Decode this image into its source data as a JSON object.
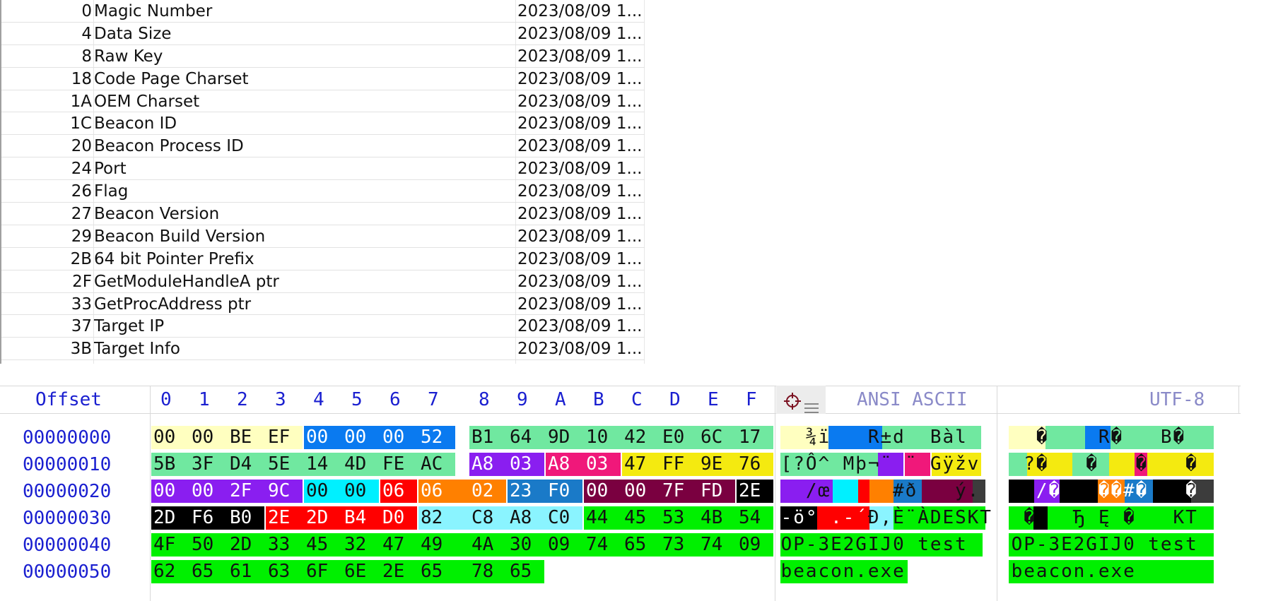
{
  "template_table": {
    "rows": [
      {
        "offset": "0",
        "name": "Magic Number",
        "date": "2023/08/09  1..."
      },
      {
        "offset": "4",
        "name": "Data Size",
        "date": "2023/08/09  1..."
      },
      {
        "offset": "8",
        "name": "Raw Key",
        "date": "2023/08/09  1..."
      },
      {
        "offset": "18",
        "name": "Code Page Charset",
        "date": "2023/08/09  1..."
      },
      {
        "offset": "1A",
        "name": "OEM Charset",
        "date": "2023/08/09  1..."
      },
      {
        "offset": "1C",
        "name": "Beacon ID",
        "date": "2023/08/09  1..."
      },
      {
        "offset": "20",
        "name": "Beacon Process ID",
        "date": "2023/08/09  1..."
      },
      {
        "offset": "24",
        "name": "Port",
        "date": "2023/08/09  1..."
      },
      {
        "offset": "26",
        "name": "Flag",
        "date": "2023/08/09  1..."
      },
      {
        "offset": "27",
        "name": "Beacon Version",
        "date": "2023/08/09  1..."
      },
      {
        "offset": "29",
        "name": "Beacon Build Version",
        "date": "2023/08/09  1..."
      },
      {
        "offset": "2B",
        "name": "64 bit Pointer Prefix",
        "date": "2023/08/09  1..."
      },
      {
        "offset": "2F",
        "name": "GetModuleHandleA ptr",
        "date": "2023/08/09  1..."
      },
      {
        "offset": "33",
        "name": "GetProcAddress ptr",
        "date": "2023/08/09  1..."
      },
      {
        "offset": "37",
        "name": "Target IP",
        "date": "2023/08/09  1..."
      },
      {
        "offset": "3B",
        "name": "Target Info",
        "date": "2023/08/09  1..."
      }
    ]
  },
  "hex_view": {
    "offset_header": "Offset",
    "col_headers": [
      "0",
      "1",
      "2",
      "3",
      "4",
      "5",
      "6",
      "7",
      "8",
      "9",
      "A",
      "B",
      "C",
      "D",
      "E",
      "F"
    ],
    "ansi_header": "ANSI ASCII",
    "utf8_header": "UTF-8",
    "header_icons": [
      "crosshair-icon",
      "lines-icon"
    ],
    "colors": {
      "header_text": "#1a1fd0",
      "ansi_header_text": "#8a8ac8",
      "magic": "#ffffc0",
      "data_size": "#0a7af0",
      "raw_key": "#70e8a0",
      "charset": "#8a1ef0",
      "oem_charset": "#f0187a",
      "beacon_id": "#f4ea10",
      "process_id": "#8a1ef0",
      "port": "#00f0ff",
      "flag": "#ff0000",
      "version": "#ff8000",
      "build": "#1a7ac8",
      "ptr_prefix": "#7a0040",
      "gmh_ptr": "#000000",
      "gpa_ptr": "#ff0000",
      "target_ip": "#8af4ff",
      "target_info": "#00f000",
      "extra": "#3c3c3c"
    },
    "rows": [
      {
        "offset": "00000000",
        "bytes": [
          "00",
          "00",
          "BE",
          "EF",
          "00",
          "00",
          "00",
          "52",
          "B1",
          "64",
          "9D",
          "10",
          "42",
          "E0",
          "6C",
          "17"
        ],
        "ansi": [
          "",
          "",
          "¾",
          "ï",
          "",
          "",
          "",
          "R",
          "±",
          "d",
          "",
          "",
          "B",
          "à",
          "l",
          ""
        ],
        "utf8": [
          "",
          "",
          "�",
          "",
          "",
          "",
          "",
          "R",
          "�",
          "",
          "",
          "",
          "B",
          "�",
          "",
          ""
        ]
      },
      {
        "offset": "00000010",
        "bytes": [
          "5B",
          "3F",
          "D4",
          "5E",
          "14",
          "4D",
          "FE",
          "AC",
          "A8",
          "03",
          "A8",
          "03",
          "47",
          "FF",
          "9E",
          "76"
        ],
        "ansi": [
          "[",
          "?",
          "Ô",
          "^",
          "",
          "M",
          "þ",
          "¬",
          "¨",
          "",
          "¨",
          "",
          "G",
          "ÿ",
          "ž",
          "v"
        ],
        "utf8": [
          "",
          "?",
          "�",
          "",
          "",
          "",
          "�",
          "",
          "",
          "",
          "�",
          "",
          "",
          "",
          "�",
          ""
        ]
      },
      {
        "offset": "00000020",
        "bytes": [
          "00",
          "00",
          "2F",
          "9C",
          "00",
          "00",
          "06",
          "06",
          "02",
          "23",
          "F0",
          "00",
          "00",
          "7F",
          "FD",
          "2E"
        ],
        "ansi": [
          "",
          "",
          "/",
          "œ",
          "",
          "",
          "",
          "",
          "",
          "#",
          "ð",
          "",
          "",
          "",
          "ý",
          "."
        ],
        "utf8": [
          "",
          "",
          "/",
          "�",
          "",
          "",
          "",
          "�",
          "�",
          "#",
          "�",
          "",
          "",
          "",
          "�",
          ""
        ]
      },
      {
        "offset": "00000030",
        "bytes": [
          "2D",
          "F6",
          "B0",
          "",
          "2E",
          "2D",
          "B4",
          "D0",
          "82",
          "C8",
          "A8",
          "C0",
          "44",
          "45",
          "53",
          "4B",
          "54"
        ],
        "ansi": [
          "-",
          "ö",
          "°",
          "",
          ".",
          "-",
          "´",
          "Ð",
          ",",
          "È",
          "¨",
          "À",
          "D",
          "E",
          "S",
          "K",
          "T"
        ],
        "utf8": [
          "",
          "�",
          "",
          "",
          "",
          "Ђ",
          "",
          "Ę",
          "",
          "�",
          "",
          "",
          "",
          "K",
          "T"
        ]
      },
      {
        "offset": "00000040",
        "bytes": [
          "4F",
          "50",
          "2D",
          "33",
          "45",
          "32",
          "47",
          "49",
          "4A",
          "30",
          "09",
          "74",
          "65",
          "73",
          "74",
          "09"
        ],
        "ansi": [
          "O",
          "P",
          "-",
          "3",
          "E",
          "2",
          "G",
          "I",
          "J",
          "0",
          "",
          "t",
          "e",
          "s",
          "t",
          ""
        ],
        "utf8": [
          "O",
          "P",
          "-",
          "3",
          "E",
          "2",
          "G",
          "I",
          "J",
          "0",
          "",
          "t",
          "e",
          "s",
          "t",
          ""
        ]
      },
      {
        "offset": "00000050",
        "bytes": [
          "62",
          "65",
          "61",
          "63",
          "6F",
          "6E",
          "2E",
          "65",
          "78",
          "65"
        ],
        "ansi": [
          "b",
          "e",
          "a",
          "c",
          "o",
          "n",
          ".",
          "e",
          "x",
          "e"
        ],
        "utf8": [
          "b",
          "e",
          "a",
          "c",
          "o",
          "n",
          ".",
          "e",
          "x",
          "e"
        ]
      }
    ]
  }
}
